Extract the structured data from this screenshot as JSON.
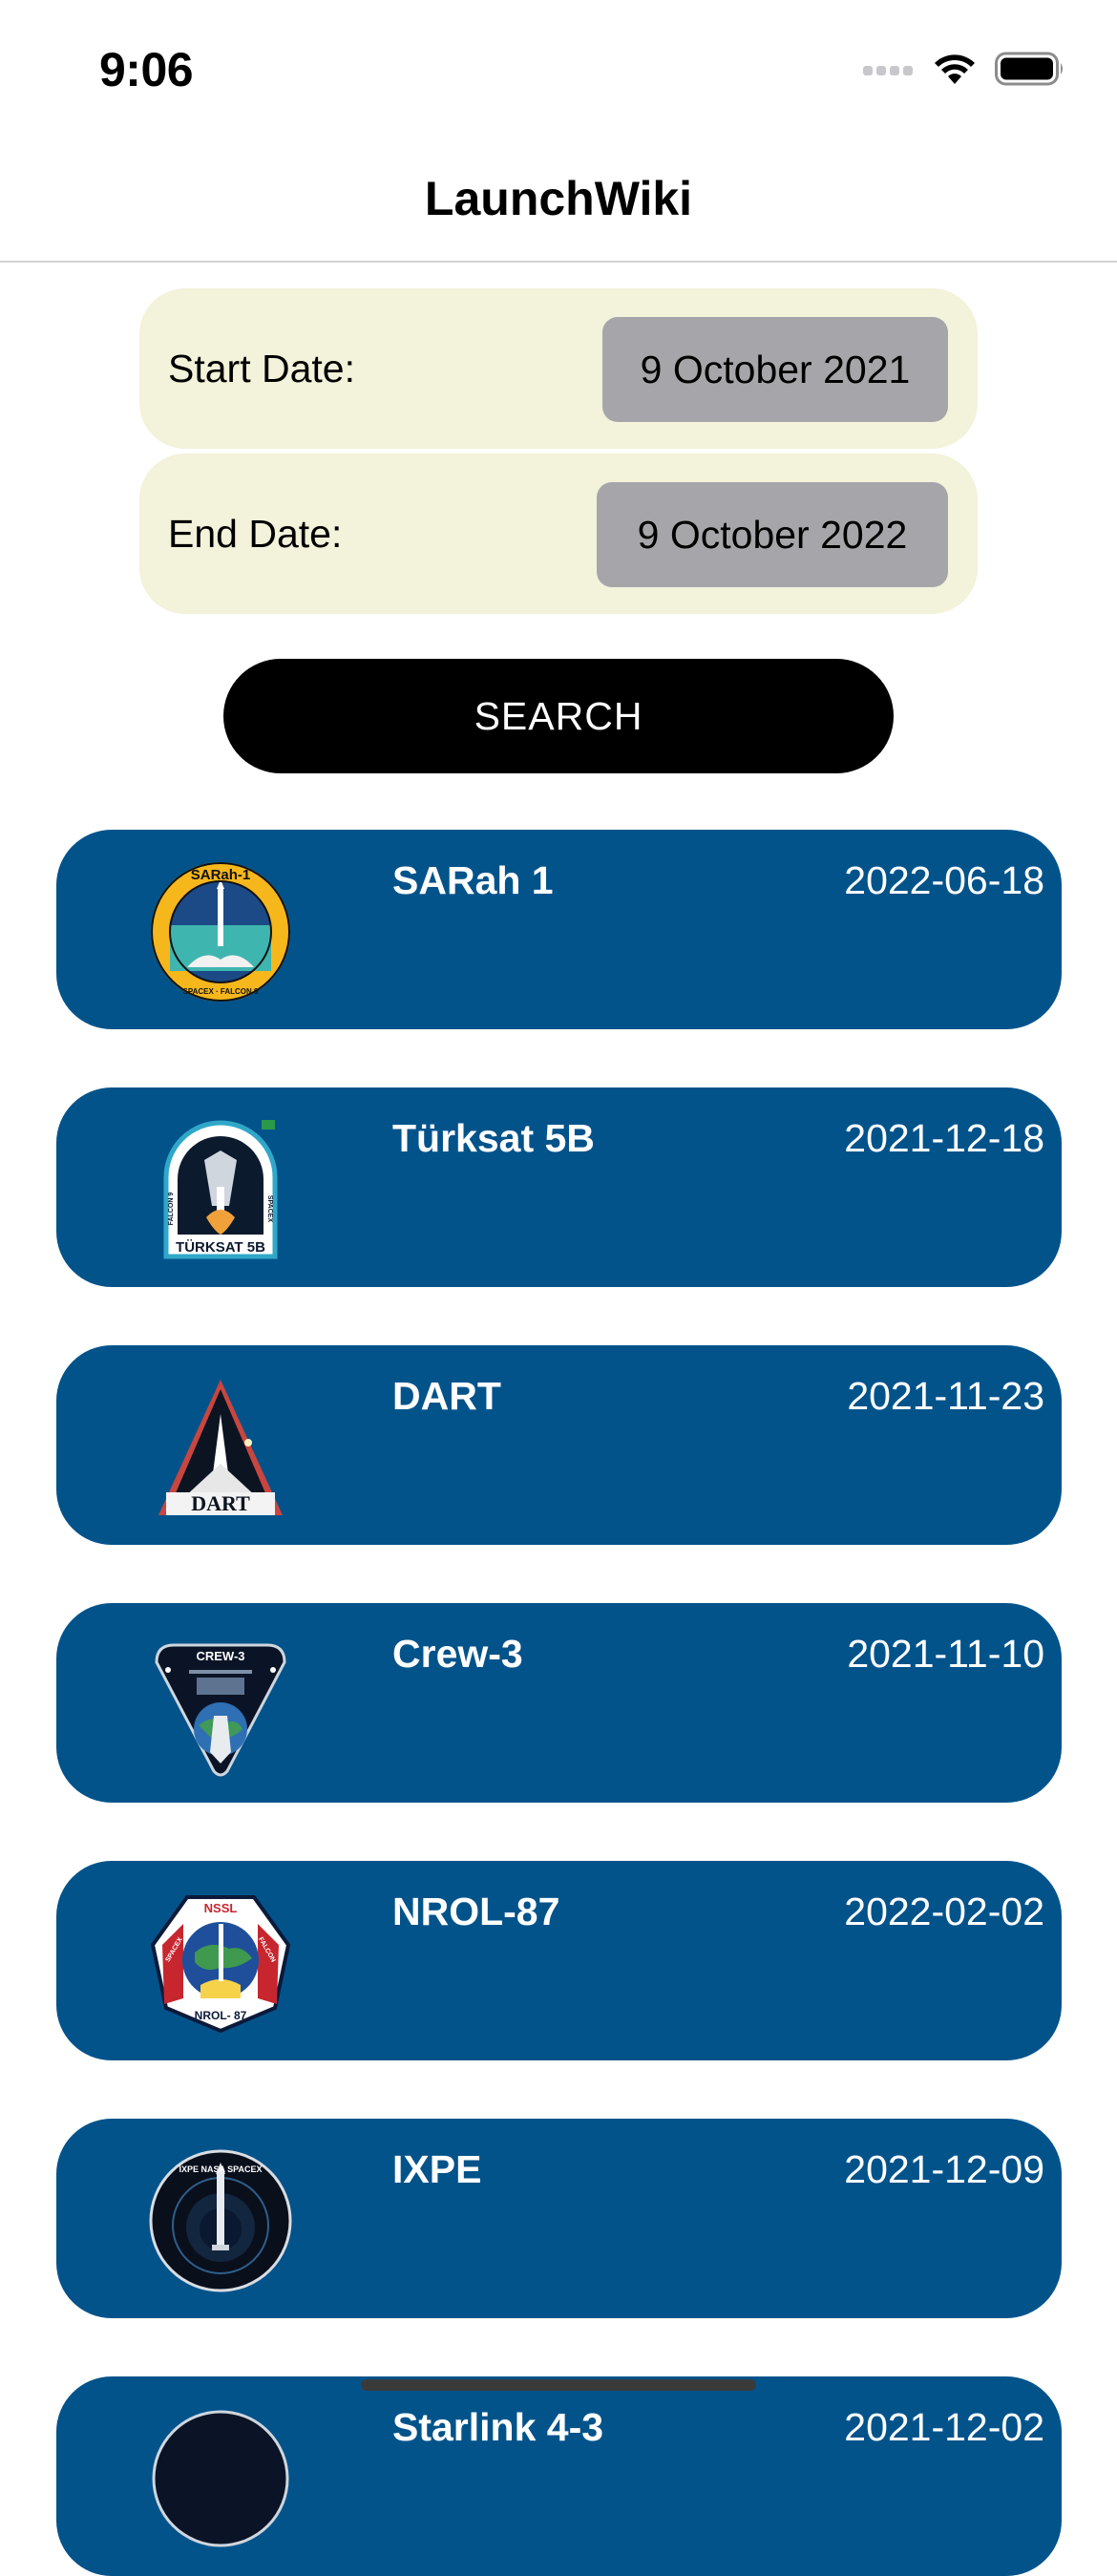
{
  "status_bar": {
    "time": "9:06"
  },
  "nav": {
    "title": "LaunchWiki"
  },
  "filters": {
    "start_label": "Start Date:",
    "start_value": "9 October 2021",
    "end_label": "End Date:",
    "end_value": "9 October 2022"
  },
  "search_button": {
    "label": "SEARCH"
  },
  "launches": [
    {
      "name": "SARah 1",
      "date": "2022-06-18",
      "patch": "sarah-1-mission-patch"
    },
    {
      "name": "Türksat 5B",
      "date": "2021-12-18",
      "patch": "turksat-5b-mission-patch"
    },
    {
      "name": "DART",
      "date": "2021-11-23",
      "patch": "dart-mission-patch"
    },
    {
      "name": "Crew-3",
      "date": "2021-11-10",
      "patch": "crew-3-mission-patch"
    },
    {
      "name": "NROL-87",
      "date": "2022-02-02",
      "patch": "nrol-87-mission-patch"
    },
    {
      "name": "IXPE",
      "date": "2021-12-09",
      "patch": "ixpe-mission-patch"
    },
    {
      "name": "Starlink 4-3",
      "date": "2021-12-02",
      "patch": "starlink-mission-patch"
    }
  ],
  "patch_text": {
    "sarah": "SARah-1",
    "sarah_bottom": "SPACEX · FALCON 9",
    "turksat": "TÜRKSAT 5B",
    "turksat_left": "FALCON 9",
    "turksat_right": "SPACEX",
    "dart": "DART",
    "crew": "CREW-3",
    "nrol_top": "NSSL",
    "nrol_bottom": "NROL- 87",
    "nrol_left": "SPACEX",
    "nrol_right": "FALCON",
    "ixpe": "IXPE NASA SPACEX"
  },
  "colors": {
    "card_background": "#03538b",
    "date_panel_background": "#f3f2da",
    "date_pill_background": "#a6a6aa",
    "search_button_background": "#000000"
  }
}
